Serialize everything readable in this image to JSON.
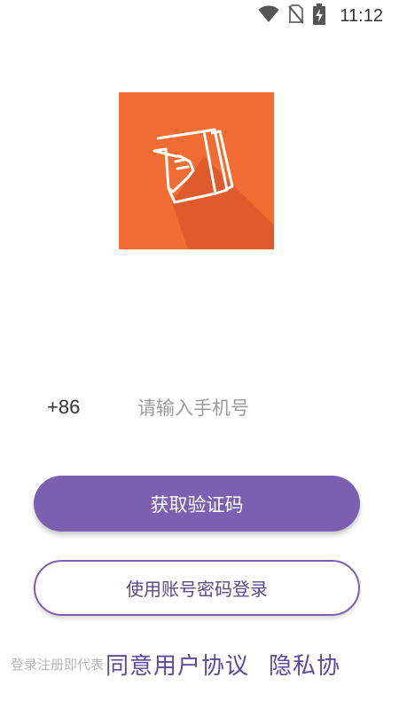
{
  "status_bar": {
    "time": "11:12",
    "icons": [
      "wifi-icon",
      "no-sim-icon",
      "battery-charging-icon"
    ]
  },
  "logo": {
    "icon": "document-hand-icon",
    "background_color": "#f26c33"
  },
  "phone": {
    "country_code": "+86",
    "placeholder": "请输入手机号",
    "value": ""
  },
  "actions": {
    "get_code_label": "获取验证码",
    "account_login_label": "使用账号密码登录"
  },
  "agreement": {
    "prefix": "登录注册即代表",
    "user_agreement": "同意用户协议",
    "privacy_policy": "隐私协"
  },
  "colors": {
    "accent": "#7b60b1",
    "accent_text": "#5a4a86",
    "muted": "#b5b5b5"
  }
}
